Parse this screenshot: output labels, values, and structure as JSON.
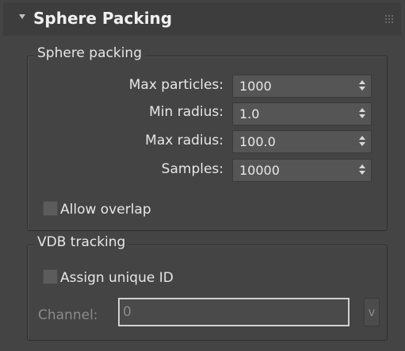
{
  "rollout": {
    "title": "Sphere Packing"
  },
  "sphere_packing_group": {
    "title": "Sphere packing",
    "fields": [
      {
        "label": "Max particles:",
        "value": "1000"
      },
      {
        "label": "Min radius:",
        "value": "1.0"
      },
      {
        "label": "Max radius:",
        "value": "100.0"
      },
      {
        "label": "Samples:",
        "value": "10000"
      }
    ],
    "allow_overlap": {
      "label": "Allow overlap",
      "checked": false
    }
  },
  "vdb_tracking_group": {
    "title": "VDB tracking",
    "assign_unique_id": {
      "label": "Assign unique ID",
      "checked": false
    },
    "channel": {
      "label": "Channel:",
      "value": "0",
      "button_label": "v"
    }
  }
}
